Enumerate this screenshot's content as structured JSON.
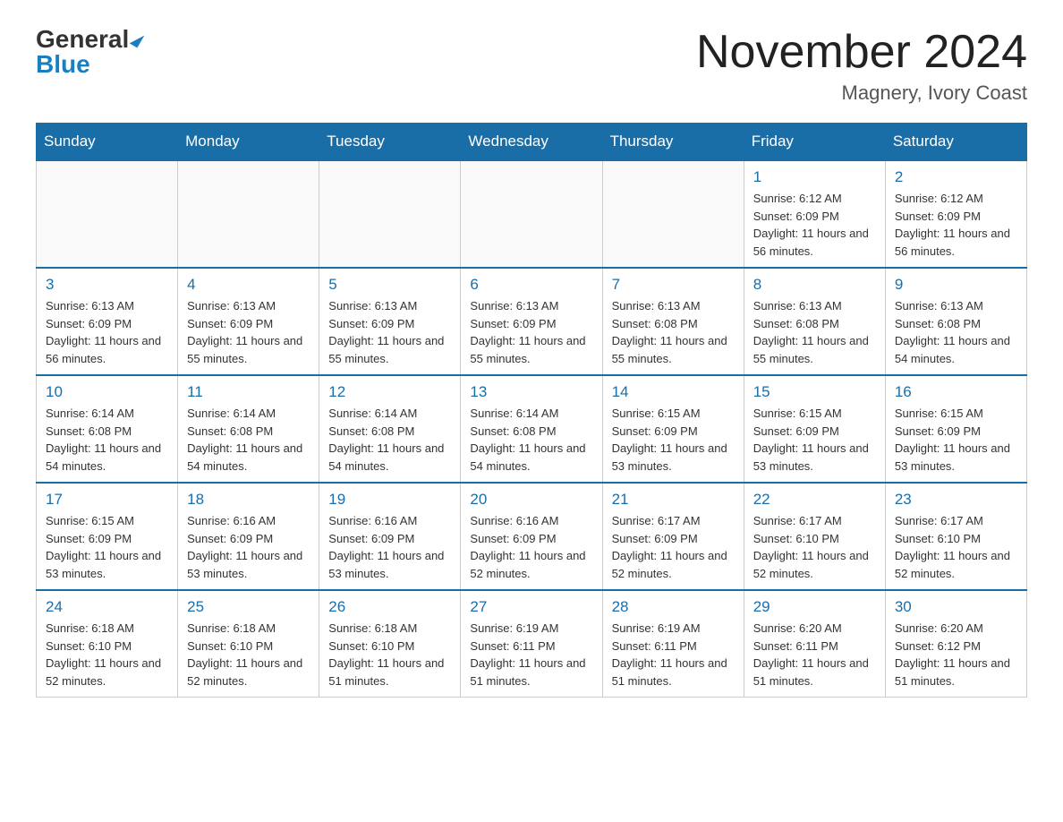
{
  "header": {
    "logo_general": "General",
    "logo_blue": "Blue",
    "month_title": "November 2024",
    "location": "Magnery, Ivory Coast"
  },
  "weekdays": [
    "Sunday",
    "Monday",
    "Tuesday",
    "Wednesday",
    "Thursday",
    "Friday",
    "Saturday"
  ],
  "weeks": [
    [
      {
        "day": "",
        "info": ""
      },
      {
        "day": "",
        "info": ""
      },
      {
        "day": "",
        "info": ""
      },
      {
        "day": "",
        "info": ""
      },
      {
        "day": "",
        "info": ""
      },
      {
        "day": "1",
        "info": "Sunrise: 6:12 AM\nSunset: 6:09 PM\nDaylight: 11 hours and 56 minutes."
      },
      {
        "day": "2",
        "info": "Sunrise: 6:12 AM\nSunset: 6:09 PM\nDaylight: 11 hours and 56 minutes."
      }
    ],
    [
      {
        "day": "3",
        "info": "Sunrise: 6:13 AM\nSunset: 6:09 PM\nDaylight: 11 hours and 56 minutes."
      },
      {
        "day": "4",
        "info": "Sunrise: 6:13 AM\nSunset: 6:09 PM\nDaylight: 11 hours and 55 minutes."
      },
      {
        "day": "5",
        "info": "Sunrise: 6:13 AM\nSunset: 6:09 PM\nDaylight: 11 hours and 55 minutes."
      },
      {
        "day": "6",
        "info": "Sunrise: 6:13 AM\nSunset: 6:09 PM\nDaylight: 11 hours and 55 minutes."
      },
      {
        "day": "7",
        "info": "Sunrise: 6:13 AM\nSunset: 6:08 PM\nDaylight: 11 hours and 55 minutes."
      },
      {
        "day": "8",
        "info": "Sunrise: 6:13 AM\nSunset: 6:08 PM\nDaylight: 11 hours and 55 minutes."
      },
      {
        "day": "9",
        "info": "Sunrise: 6:13 AM\nSunset: 6:08 PM\nDaylight: 11 hours and 54 minutes."
      }
    ],
    [
      {
        "day": "10",
        "info": "Sunrise: 6:14 AM\nSunset: 6:08 PM\nDaylight: 11 hours and 54 minutes."
      },
      {
        "day": "11",
        "info": "Sunrise: 6:14 AM\nSunset: 6:08 PM\nDaylight: 11 hours and 54 minutes."
      },
      {
        "day": "12",
        "info": "Sunrise: 6:14 AM\nSunset: 6:08 PM\nDaylight: 11 hours and 54 minutes."
      },
      {
        "day": "13",
        "info": "Sunrise: 6:14 AM\nSunset: 6:08 PM\nDaylight: 11 hours and 54 minutes."
      },
      {
        "day": "14",
        "info": "Sunrise: 6:15 AM\nSunset: 6:09 PM\nDaylight: 11 hours and 53 minutes."
      },
      {
        "day": "15",
        "info": "Sunrise: 6:15 AM\nSunset: 6:09 PM\nDaylight: 11 hours and 53 minutes."
      },
      {
        "day": "16",
        "info": "Sunrise: 6:15 AM\nSunset: 6:09 PM\nDaylight: 11 hours and 53 minutes."
      }
    ],
    [
      {
        "day": "17",
        "info": "Sunrise: 6:15 AM\nSunset: 6:09 PM\nDaylight: 11 hours and 53 minutes."
      },
      {
        "day": "18",
        "info": "Sunrise: 6:16 AM\nSunset: 6:09 PM\nDaylight: 11 hours and 53 minutes."
      },
      {
        "day": "19",
        "info": "Sunrise: 6:16 AM\nSunset: 6:09 PM\nDaylight: 11 hours and 53 minutes."
      },
      {
        "day": "20",
        "info": "Sunrise: 6:16 AM\nSunset: 6:09 PM\nDaylight: 11 hours and 52 minutes."
      },
      {
        "day": "21",
        "info": "Sunrise: 6:17 AM\nSunset: 6:09 PM\nDaylight: 11 hours and 52 minutes."
      },
      {
        "day": "22",
        "info": "Sunrise: 6:17 AM\nSunset: 6:10 PM\nDaylight: 11 hours and 52 minutes."
      },
      {
        "day": "23",
        "info": "Sunrise: 6:17 AM\nSunset: 6:10 PM\nDaylight: 11 hours and 52 minutes."
      }
    ],
    [
      {
        "day": "24",
        "info": "Sunrise: 6:18 AM\nSunset: 6:10 PM\nDaylight: 11 hours and 52 minutes."
      },
      {
        "day": "25",
        "info": "Sunrise: 6:18 AM\nSunset: 6:10 PM\nDaylight: 11 hours and 52 minutes."
      },
      {
        "day": "26",
        "info": "Sunrise: 6:18 AM\nSunset: 6:10 PM\nDaylight: 11 hours and 51 minutes."
      },
      {
        "day": "27",
        "info": "Sunrise: 6:19 AM\nSunset: 6:11 PM\nDaylight: 11 hours and 51 minutes."
      },
      {
        "day": "28",
        "info": "Sunrise: 6:19 AM\nSunset: 6:11 PM\nDaylight: 11 hours and 51 minutes."
      },
      {
        "day": "29",
        "info": "Sunrise: 6:20 AM\nSunset: 6:11 PM\nDaylight: 11 hours and 51 minutes."
      },
      {
        "day": "30",
        "info": "Sunrise: 6:20 AM\nSunset: 6:12 PM\nDaylight: 11 hours and 51 minutes."
      }
    ]
  ]
}
